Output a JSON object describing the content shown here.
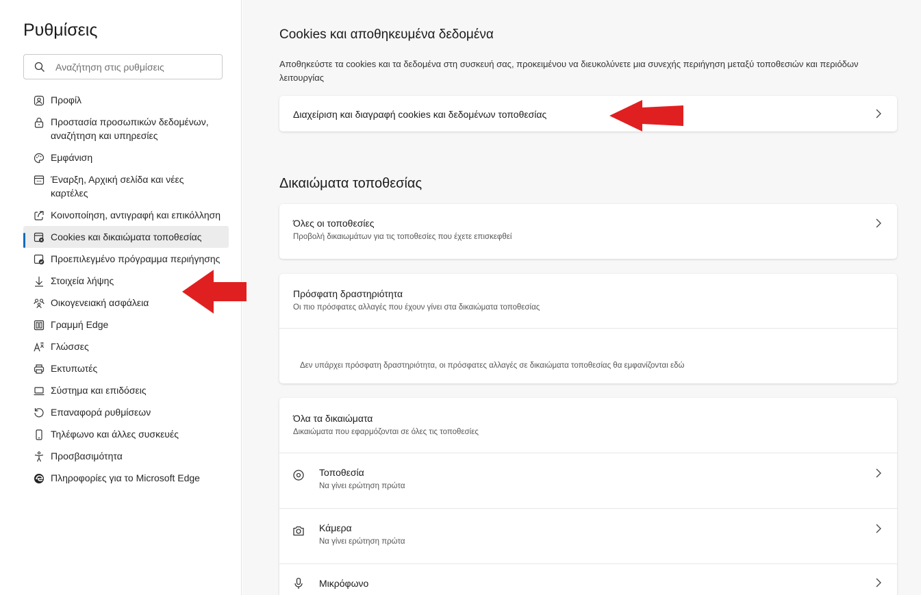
{
  "sidebar": {
    "title": "Ρυθμίσεις",
    "search_placeholder": "Αναζήτηση στις ρυθμίσεις",
    "items": [
      {
        "label": "Προφίλ",
        "icon": "profile-icon"
      },
      {
        "label": "Προστασία προσωπικών δεδομένων, αναζήτηση και υπηρεσίες",
        "icon": "lock-icon"
      },
      {
        "label": "Εμφάνιση",
        "icon": "palette-icon"
      },
      {
        "label": "Έναρξη, Αρχική σελίδα και νέες καρτέλες",
        "icon": "window-icon"
      },
      {
        "label": "Κοινοποίηση, αντιγραφή και επικόλληση",
        "icon": "share-icon"
      },
      {
        "label": "Cookies και δικαιώματα τοποθεσίας",
        "icon": "cookies-site-icon",
        "active": true
      },
      {
        "label": "Προεπιλεγμένο πρόγραμμα περιήγησης",
        "icon": "default-browser-icon"
      },
      {
        "label": "Στοιχεία λήψης",
        "icon": "download-icon"
      },
      {
        "label": "Οικογενειακή ασφάλεια",
        "icon": "family-icon"
      },
      {
        "label": "Γραμμή Edge",
        "icon": "edge-bar-icon"
      },
      {
        "label": "Γλώσσες",
        "icon": "language-icon"
      },
      {
        "label": "Εκτυπωτές",
        "icon": "printer-icon"
      },
      {
        "label": "Σύστημα και επιδόσεις",
        "icon": "laptop-icon"
      },
      {
        "label": "Επαναφορά ρυθμίσεων",
        "icon": "reset-icon"
      },
      {
        "label": "Τηλέφωνο και άλλες συσκευές",
        "icon": "phone-icon"
      },
      {
        "label": "Προσβασιμότητα",
        "icon": "accessibility-icon"
      },
      {
        "label": "Πληροφορίες για το Microsoft Edge",
        "icon": "edge-logo-icon"
      }
    ]
  },
  "main": {
    "cookies_section": {
      "title": "Cookies και αποθηκευμένα δεδομένα",
      "description": "Αποθηκεύστε τα cookies και τα δεδομένα στη συσκευή σας, προκειμένου να διευκολύνετε μια συνεχής περιήγηση μεταξύ τοποθεσιών και περιόδων λειτουργίας",
      "manage_label": "Διαχείριση και διαγραφή cookies και δεδομένων τοποθεσίας"
    },
    "permissions_section": {
      "title": "Δικαιώματα τοποθεσίας",
      "all_sites": {
        "title": "Όλες οι τοποθεσίες",
        "subtitle": "Προβολή δικαιωμάτων για τις τοποθεσίες που έχετε επισκεφθεί"
      },
      "recent_activity": {
        "title": "Πρόσφατη δραστηριότητα",
        "subtitle": "Οι πιο πρόσφατες αλλαγές που έχουν γίνει στα δικαιώματα τοποθεσίας",
        "empty_text": "Δεν υπάρχει πρόσφατη δραστηριότητα, οι πρόσφατες αλλαγές σε δικαιώματα τοποθεσίας θα εμφανίζονται εδώ"
      },
      "all_permissions": {
        "title": "Όλα τα δικαιώματα",
        "subtitle": "Δικαιώματα που εφαρμόζονται σε όλες τις τοποθεσίες",
        "items": [
          {
            "title": "Τοποθεσία",
            "subtitle": "Να γίνει ερώτηση πρώτα",
            "icon": "location-icon"
          },
          {
            "title": "Κάμερα",
            "subtitle": "Να γίνει ερώτηση πρώτα",
            "icon": "camera-icon"
          },
          {
            "title": "Μικρόφωνο",
            "icon": "microphone-icon"
          }
        ]
      }
    }
  },
  "colors": {
    "accent": "#0f6cbd",
    "annotation_arrow": "#e02020",
    "main_background": "#f7f7f7"
  }
}
